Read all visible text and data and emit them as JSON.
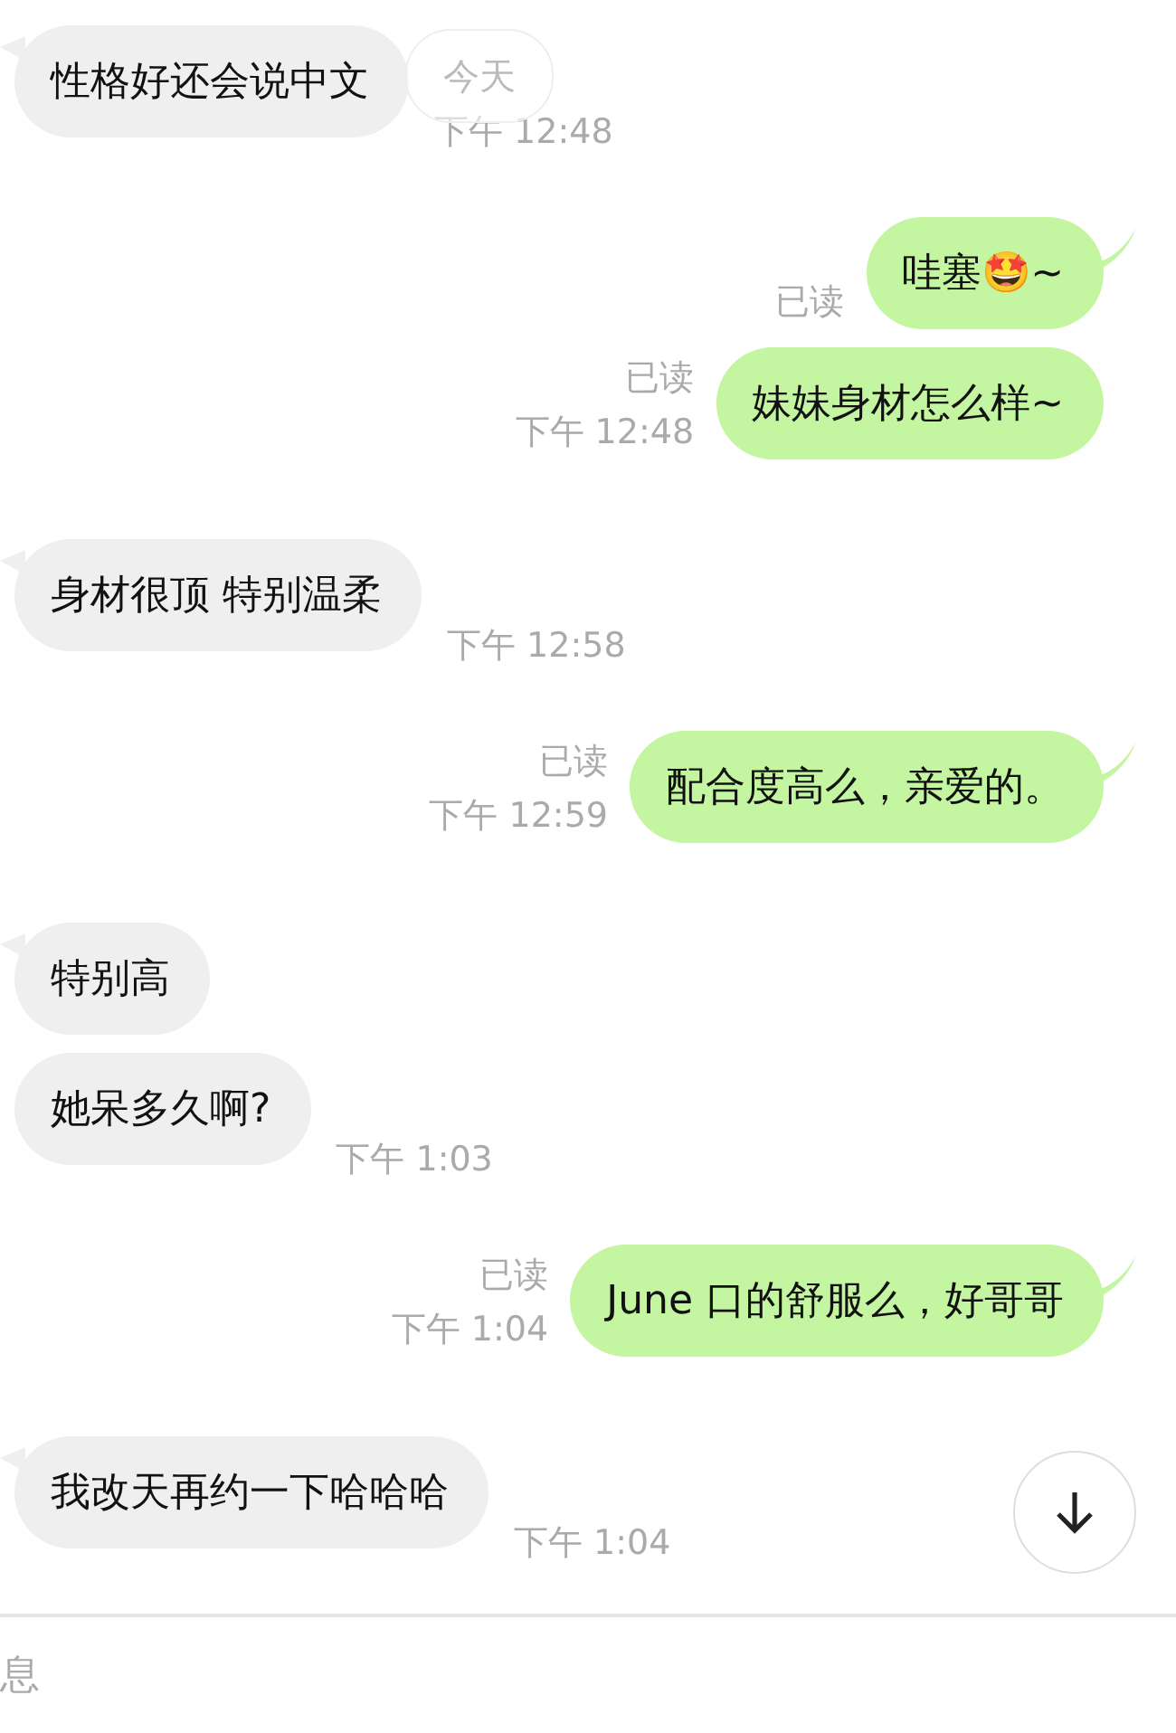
{
  "date_badge": "今天",
  "messages": [
    {
      "kind": "incoming",
      "text": "性格好还会说中文",
      "tail": true,
      "time": "下午 12:48"
    },
    {
      "kind": "outgoing",
      "text": "哇塞🤩~",
      "tail": true,
      "read": "已读"
    },
    {
      "kind": "outgoing",
      "text": "妹妹身材怎么样~",
      "tail": false,
      "read": "已读",
      "time": "下午 12:48"
    },
    {
      "kind": "incoming",
      "text": "身材很顶 特别温柔",
      "tail": true,
      "time": "下午 12:58"
    },
    {
      "kind": "outgoing",
      "text": "配合度高么，亲爱的。",
      "tail": true,
      "read": "已读",
      "time": "下午 12:59"
    },
    {
      "kind": "incoming",
      "text": "特别高",
      "tail": true
    },
    {
      "kind": "incoming",
      "text": "她呆多久啊?",
      "tail": false,
      "time": "下午 1:03"
    },
    {
      "kind": "outgoing",
      "text": "June 口的舒服么，好哥哥",
      "tail": true,
      "read": "已读",
      "time": "下午 1:04"
    },
    {
      "kind": "incoming",
      "text": "我改天再约一下哈哈哈",
      "tail": true,
      "time": "下午 1:04"
    }
  ],
  "composer": {
    "placeholder": "息"
  }
}
